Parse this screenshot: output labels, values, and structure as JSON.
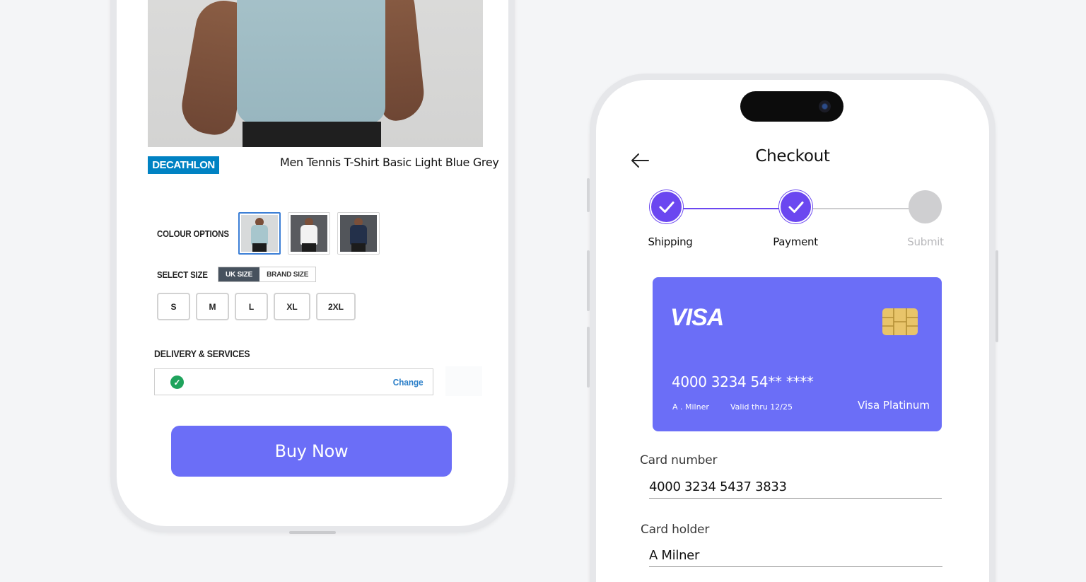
{
  "product_screen": {
    "brand": "DECATHLON",
    "product_title": "Men Tennis T-Shirt Basic Light Blue Grey",
    "colour_options_label": "COLOUR OPTIONS",
    "colour_swatches": [
      {
        "name": "light-blue",
        "shirt_color": "#a7c6cd",
        "selected": true
      },
      {
        "name": "white",
        "shirt_color": "#f2f2f2",
        "selected": false
      },
      {
        "name": "navy",
        "shirt_color": "#23304a",
        "selected": false
      }
    ],
    "select_size_label": "SELECT SIZE",
    "size_toggle": {
      "active": "UK SIZE",
      "inactive": "BRAND SIZE"
    },
    "sizes": [
      "S",
      "M",
      "L",
      "XL",
      "2XL"
    ],
    "delivery_label": "DELIVERY & SERVICES",
    "delivery_change": "Change",
    "buy_now": "Buy Now",
    "colors": {
      "accent": "#6b6ef7",
      "brand": "#0082c3",
      "success": "#1fa35c",
      "link": "#2a7ec8"
    }
  },
  "checkout_screen": {
    "title": "Checkout",
    "back_icon": "arrow-left-icon",
    "steps": [
      {
        "label": "Shipping",
        "status": "done"
      },
      {
        "label": "Payment",
        "status": "done"
      },
      {
        "label": "Submit",
        "status": "pending"
      }
    ],
    "card": {
      "network": "VISA",
      "masked_number": "4000 3234 54** ****",
      "holder": "A . Milner",
      "valid_thru": "Valid thru 12/25",
      "type": "Visa Platinum",
      "color": "#6b6ef7"
    },
    "fields": {
      "card_number_label": "Card number",
      "card_number_value": "4000 3234 5437 3833",
      "card_holder_label": "Card holder",
      "card_holder_value": "A Milner"
    },
    "colors": {
      "step_done": "#6b47f0",
      "step_pending": "#cfcfd1",
      "submit_text": "#b8b8bb"
    }
  }
}
